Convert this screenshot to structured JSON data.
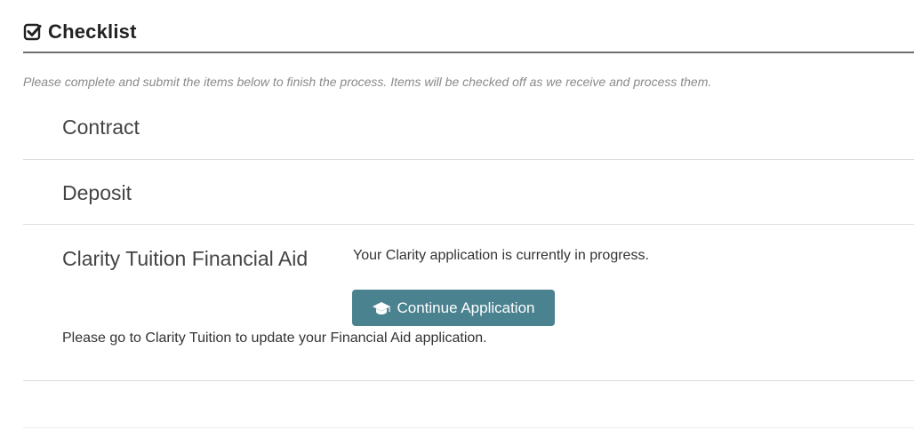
{
  "header": {
    "title": "Checklist",
    "icon": "check-square-icon"
  },
  "instructions": "Please complete and submit the items below to finish the process. Items will be checked off as we receive and process them.",
  "items": [
    {
      "label": "Contract"
    },
    {
      "label": "Deposit"
    },
    {
      "label": "Clarity Tuition Financial Aid",
      "status": "Your Clarity application is currently in progress.",
      "button": {
        "label": "Continue Application",
        "icon": "graduation-cap-icon"
      },
      "note": "Please go to Clarity Tuition to update your Financial Aid application."
    }
  ],
  "colors": {
    "button_bg": "#4a8290",
    "button_text": "#ffffff",
    "title_text": "#222222",
    "instruction_text": "#8a8a8a"
  }
}
